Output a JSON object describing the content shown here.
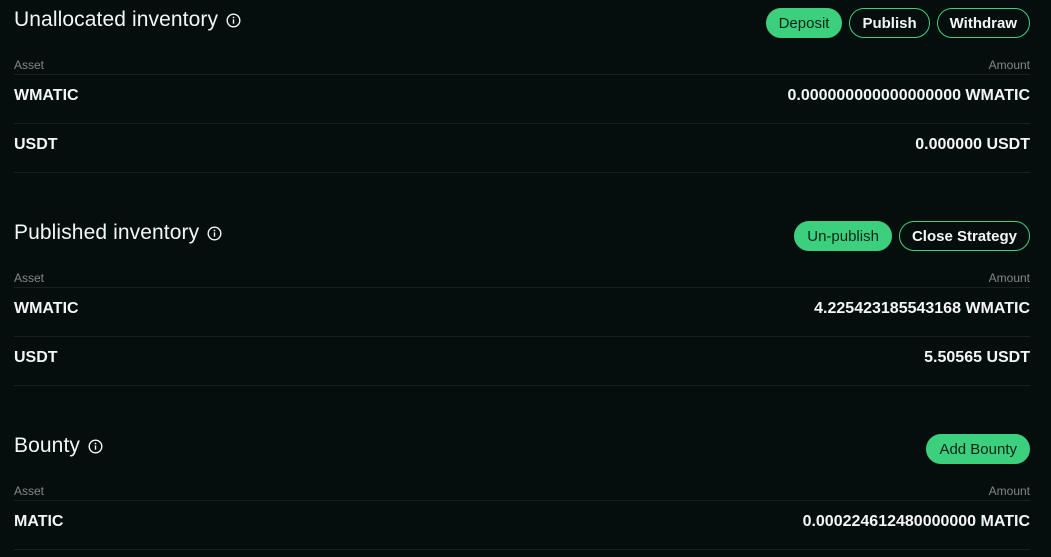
{
  "sections": [
    {
      "title": "Unallocated inventory",
      "buttons": [
        "Deposit",
        "Publish",
        "Withdraw"
      ],
      "columns": {
        "asset": "Asset",
        "amount": "Amount"
      },
      "rows": [
        {
          "asset": "WMATIC",
          "amount": "0.000000000000000000 WMATIC"
        },
        {
          "asset": "USDT",
          "amount": "0.000000 USDT"
        }
      ]
    },
    {
      "title": "Published inventory",
      "buttons": [
        "Un-publish",
        "Close Strategy"
      ],
      "columns": {
        "asset": "Asset",
        "amount": "Amount"
      },
      "rows": [
        {
          "asset": "WMATIC",
          "amount": "4.225423185543168 WMATIC"
        },
        {
          "asset": "USDT",
          "amount": "5.50565 USDT"
        }
      ]
    },
    {
      "title": "Bounty",
      "buttons": [
        "Add Bounty"
      ],
      "columns": {
        "asset": "Asset",
        "amount": "Amount"
      },
      "rows": [
        {
          "asset": "MATIC",
          "amount": "0.000224612480000000 MATIC"
        }
      ]
    }
  ],
  "icons": {
    "info": "info-circle-icon"
  },
  "colors": {
    "background": "#040e0c",
    "accent": "#3cd07e",
    "text": "#f3f6f5",
    "muted": "#7f8a87",
    "divider": "#16211e"
  }
}
